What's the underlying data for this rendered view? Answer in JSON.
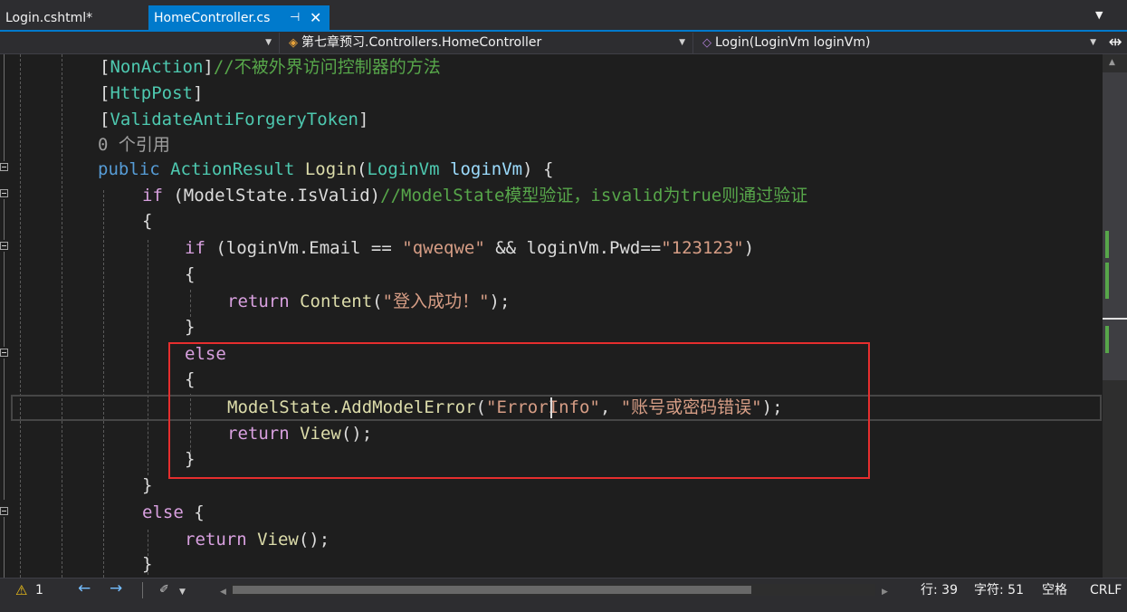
{
  "tabs": [
    {
      "label": "Login.cshtml*",
      "active": false
    },
    {
      "label": "HomeController.cs",
      "active": true,
      "pin_icon": "⊣",
      "close_icon": "✕"
    }
  ],
  "navbar": {
    "project": "",
    "class_path": "第七章预习.Controllers.HomeController",
    "member": "Login(LoginVm loginVm)",
    "class_icon": "class-icon",
    "member_icon": "method-icon"
  },
  "code": {
    "line1_attr": "NonAction",
    "line1_comment": "//不被外界访问控制器的方法",
    "line2_attr": "HttpPost",
    "line3_attr": "ValidateAntiForgeryToken",
    "line4_refs": "0 个引用",
    "line5_public": "public",
    "line5_type": "ActionResult",
    "line5_method": "Login",
    "line5_param_type": "LoginVm",
    "line5_param": "loginVm",
    "line6_if": "if",
    "line6_cond": "(ModelState.IsValid)",
    "line6_comment": "//ModelState模型验证，isvalid为true则通过验证",
    "line8_if": "if",
    "line8_cond_a": "(loginVm.Email == ",
    "line8_str_a": "\"qweqwe\"",
    "line8_and": " && loginVm.Pwd==",
    "line8_str_b": "\"123123\"",
    "line8_close": ")",
    "line10_return": "return",
    "line10_call": "Content",
    "line10_str": "\"登入成功！\"",
    "line12_else": "else",
    "line14_call": "ModelState.AddModelError",
    "line14_str_a": "\"ErrorInfo\"",
    "line14_str_b": "\"账号或密码错误\"",
    "line15_return": "return",
    "line15_call": "View",
    "line18_else": "else",
    "line19_return": "return",
    "line19_call": "View"
  },
  "statusbar": {
    "warnings": "1",
    "line": "行: 39",
    "column": "字符: 51",
    "whitespace": "空格",
    "line_ending": "CRLF"
  },
  "colors": {
    "accent": "#007acc",
    "highlight_box": "#e62e2e"
  }
}
